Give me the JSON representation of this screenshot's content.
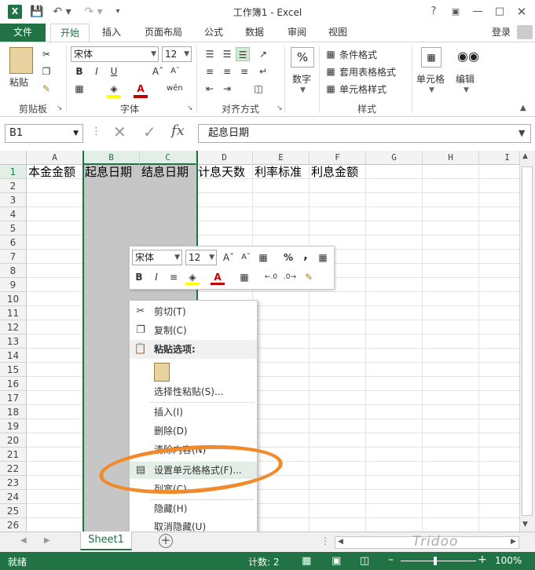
{
  "window": {
    "title": "工作簿1 - Excel",
    "help": "?",
    "controls": [
      "restore-ribbon",
      "minimize",
      "maximize",
      "close"
    ]
  },
  "quick_access": {
    "save_icon": "save-icon",
    "undo_icon": "undo-icon",
    "redo_icon": "redo-icon"
  },
  "tabs": {
    "file": "文件",
    "items": [
      "开始",
      "插入",
      "页面布局",
      "公式",
      "数据",
      "审阅",
      "视图"
    ],
    "active": "开始",
    "login": "登录"
  },
  "ribbon": {
    "clipboard": {
      "paste": "粘贴",
      "label": "剪贴板"
    },
    "font": {
      "name": "宋体",
      "size": "12",
      "bold": "B",
      "italic": "I",
      "underline": "U",
      "label": "字体"
    },
    "align": {
      "label": "对齐方式"
    },
    "number": {
      "label": "数字"
    },
    "styles": {
      "cond": "条件格式",
      "table": "套用表格格式",
      "cell": "单元格样式",
      "label": "样式"
    },
    "cells": {
      "label": "单元格"
    },
    "edit": {
      "label": "编辑"
    }
  },
  "formula_bar": {
    "name_box": "B1",
    "fx": "fx",
    "value": "起息日期"
  },
  "grid": {
    "columns": [
      "A",
      "B",
      "C",
      "D",
      "E",
      "F",
      "G",
      "H",
      "I"
    ],
    "rows": [
      "1",
      "2",
      "3",
      "4",
      "5",
      "6",
      "7",
      "8",
      "9",
      "10",
      "11",
      "12",
      "13",
      "14",
      "15",
      "16",
      "17",
      "18",
      "19",
      "20",
      "21",
      "22",
      "23",
      "24",
      "25",
      "26"
    ],
    "row1": [
      "本金金额",
      "起息日期",
      "结息日期",
      "计息天数",
      "利率标准",
      "利息金额"
    ],
    "selected_columns": [
      "B",
      "C"
    ]
  },
  "mini_toolbar": {
    "font": "宋体",
    "size": "12",
    "bold": "B",
    "italic": "I",
    "percent": "%",
    "comma": ","
  },
  "context_menu": {
    "cut": "剪切(T)",
    "copy": "复制(C)",
    "paste_options": "粘贴选项:",
    "paste_special": "选择性粘贴(S)...",
    "insert": "插入(I)",
    "delete": "删除(D)",
    "clear": "清除内容(N)",
    "format_cells": "设置单元格格式(F)...",
    "col_width": "列宽(C)...",
    "hide": "隐藏(H)",
    "unhide": "取消隐藏(U)"
  },
  "sheets": {
    "tab": "Sheet1",
    "add": "+"
  },
  "status": {
    "ready": "就绪",
    "count": "计数: 2",
    "zoom": "100%"
  },
  "watermark": "Tridoo",
  "colors": {
    "accent": "#217346",
    "highlight": "#f08a2a"
  }
}
